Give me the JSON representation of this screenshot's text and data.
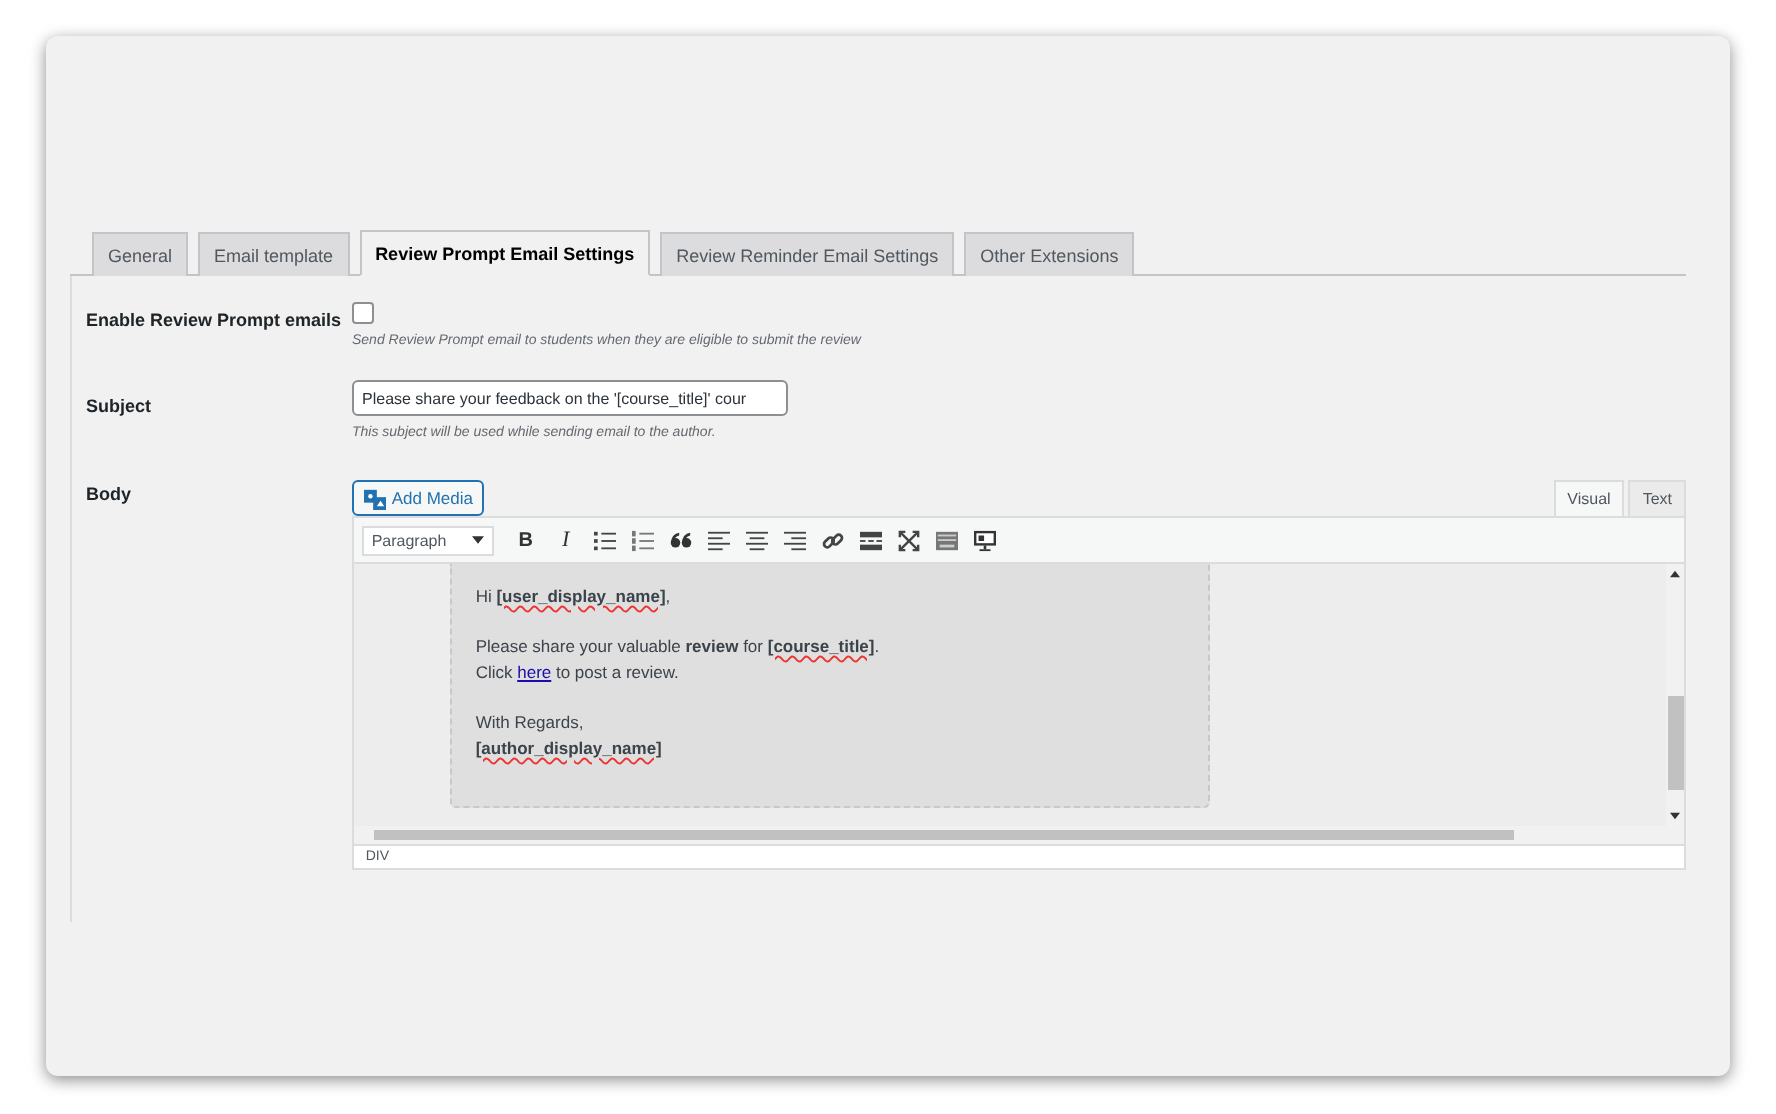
{
  "tabs": [
    {
      "label": "General",
      "selected": false
    },
    {
      "label": "Email template",
      "selected": false
    },
    {
      "label": "Review Prompt Email Settings",
      "selected": true
    },
    {
      "label": "Review Reminder Email Settings",
      "selected": false
    },
    {
      "label": "Other Extensions",
      "selected": false
    }
  ],
  "enable": {
    "label": "Enable Review Prompt emails",
    "checked": false,
    "description": "Send Review Prompt email to students when they are eligible to submit the review"
  },
  "subject": {
    "label": "Subject",
    "value": "Please share your feedback on the '[course_title]' cour",
    "description": "This subject will be used while sending email to the author."
  },
  "body": {
    "label": "Body",
    "add_media": "Add Media",
    "editor_tabs": [
      {
        "label": "Visual",
        "selected": true
      },
      {
        "label": "Text",
        "selected": false
      }
    ],
    "format_select": "Paragraph",
    "toolbar": [
      {
        "kind": "bold",
        "label": "B"
      },
      {
        "kind": "italic",
        "label": "I"
      },
      {
        "kind": "bullets"
      },
      {
        "kind": "numbers"
      },
      {
        "kind": "quote"
      },
      {
        "kind": "align-left"
      },
      {
        "kind": "align-center"
      },
      {
        "kind": "align-right"
      },
      {
        "kind": "link"
      },
      {
        "kind": "more"
      },
      {
        "kind": "fullscreen"
      },
      {
        "kind": "keyboard"
      },
      {
        "kind": "monitor"
      }
    ],
    "content": [
      {
        "paragraph_start": false,
        "segments": [
          {
            "kind": "text",
            "text": "Hi "
          },
          {
            "kind": "token",
            "text": "[user_display_name]"
          },
          {
            "kind": "text",
            "text": ","
          }
        ]
      },
      {
        "paragraph_start": true,
        "segments": [
          {
            "kind": "text",
            "text": "Please share your valuable "
          },
          {
            "kind": "bold",
            "text": "review"
          },
          {
            "kind": "text",
            "text": " for "
          },
          {
            "kind": "token",
            "text": "[course_title]"
          },
          {
            "kind": "text",
            "text": "."
          }
        ]
      },
      {
        "paragraph_start": false,
        "segments": [
          {
            "kind": "text",
            "text": "Click "
          },
          {
            "kind": "link",
            "text": "here"
          },
          {
            "kind": "text",
            "text": " to post a review."
          }
        ]
      },
      {
        "paragraph_start": true,
        "segments": [
          {
            "kind": "text",
            "text": "With Regards,"
          }
        ]
      },
      {
        "paragraph_start": false,
        "segments": [
          {
            "kind": "token",
            "text": "[author_display_name]"
          }
        ]
      }
    ],
    "status": "DIV"
  }
}
